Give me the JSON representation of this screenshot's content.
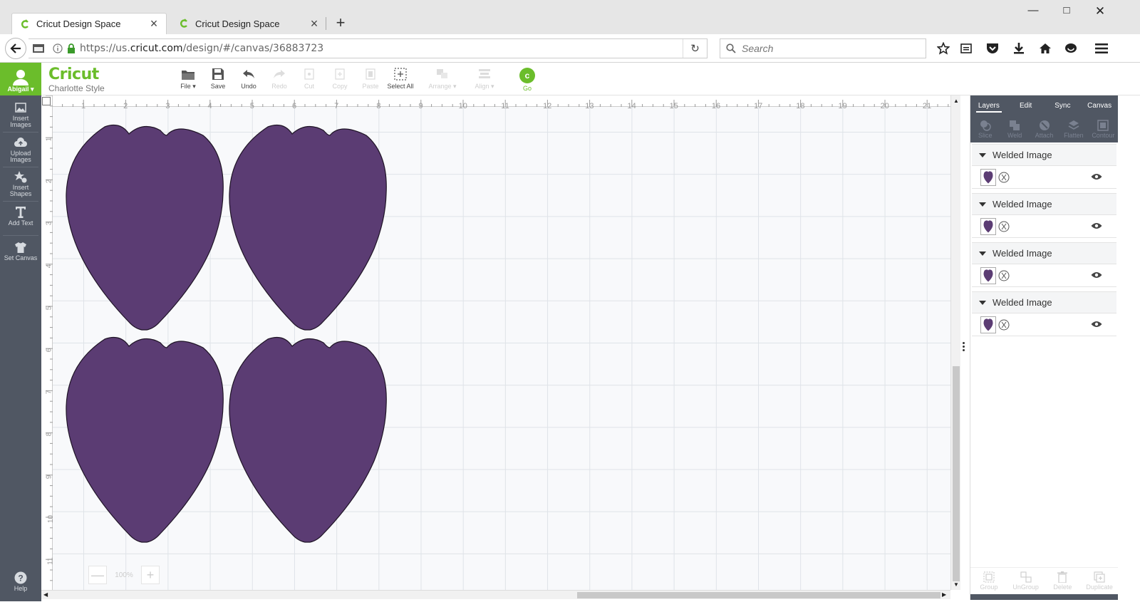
{
  "browser": {
    "tabs": [
      {
        "title": "Cricut Design Space",
        "active": true
      },
      {
        "title": "Cricut Design Space",
        "active": false
      }
    ],
    "url_prefix": "https://us.",
    "url_domain": "cricut.com",
    "url_path": "/design/#/canvas/36883723",
    "search_placeholder": "Search"
  },
  "app": {
    "user_name": "Abigail",
    "brand": "Cricut",
    "project_name": "Charlotte Style",
    "toolbar": {
      "file": "File",
      "save": "Save",
      "undo": "Undo",
      "redo": "Redo",
      "cut": "Cut",
      "copy": "Copy",
      "paste": "Paste",
      "select_all": "Select All",
      "arrange": "Arrange",
      "align": "Align",
      "go": "Go"
    },
    "accent_color": "#6bbd2b",
    "shape_color": "#5b3c73"
  },
  "sidebar": {
    "items": [
      {
        "label_1": "Insert",
        "label_2": "Images"
      },
      {
        "label_1": "Upload",
        "label_2": "Images"
      },
      {
        "label_1": "Insert",
        "label_2": "Shapes"
      },
      {
        "label_1": "Add Text",
        "label_2": ""
      },
      {
        "label_1": "Set Canvas",
        "label_2": ""
      }
    ],
    "help": "Help"
  },
  "canvas": {
    "ruler_h": [
      "1",
      "2",
      "3",
      "4",
      "5",
      "6",
      "7",
      "8",
      "9",
      "10",
      "11",
      "12",
      "13",
      "14",
      "15",
      "16",
      "17",
      "18",
      "19",
      "20",
      "21"
    ],
    "ruler_v": [
      "1",
      "2",
      "3",
      "4",
      "5",
      "6",
      "7",
      "8",
      "9",
      "10",
      "11"
    ],
    "zoom_level": "100%"
  },
  "panel": {
    "tabs": [
      "Layers",
      "Edit",
      "Sync",
      "Canvas"
    ],
    "actions": [
      "Slice",
      "Weld",
      "Attach",
      "Flatten",
      "Contour"
    ],
    "layers": [
      {
        "title": "Welded Image"
      },
      {
        "title": "Welded Image"
      },
      {
        "title": "Welded Image"
      },
      {
        "title": "Welded Image"
      }
    ],
    "bottom_actions": [
      "Group",
      "UnGroup",
      "Delete",
      "Duplicate"
    ]
  }
}
